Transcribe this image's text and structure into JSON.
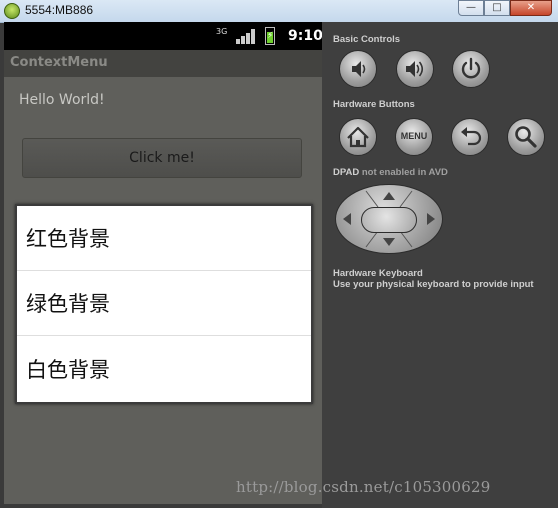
{
  "window": {
    "title": "5554:MB886",
    "minimize_label": "—",
    "maximize_label": "□",
    "close_label": "✕"
  },
  "status_bar": {
    "network": "3G",
    "time": "9:10"
  },
  "app": {
    "title": "ContextMenu",
    "hello_text": "Hello World!",
    "button_label": "Click me!"
  },
  "context_menu": {
    "items": [
      {
        "label": "红色背景"
      },
      {
        "label": "绿色背景"
      },
      {
        "label": "白色背景"
      }
    ]
  },
  "controls": {
    "basic_controls_label": "Basic Controls",
    "hardware_buttons_label": "Hardware Buttons",
    "menu_button_label": "MENU",
    "dpad_label": "DPAD",
    "dpad_note": "not enabled in AVD",
    "keyboard_label": "Hardware Keyboard",
    "keyboard_note": "Use your physical keyboard to provide input"
  },
  "watermark": "http://blog.csdn.net/c105300629",
  "icons": {
    "basic": [
      "volume-down-icon",
      "volume-up-icon",
      "power-icon"
    ],
    "hardware": [
      "home-icon",
      "menu-icon",
      "back-icon",
      "search-icon"
    ]
  }
}
